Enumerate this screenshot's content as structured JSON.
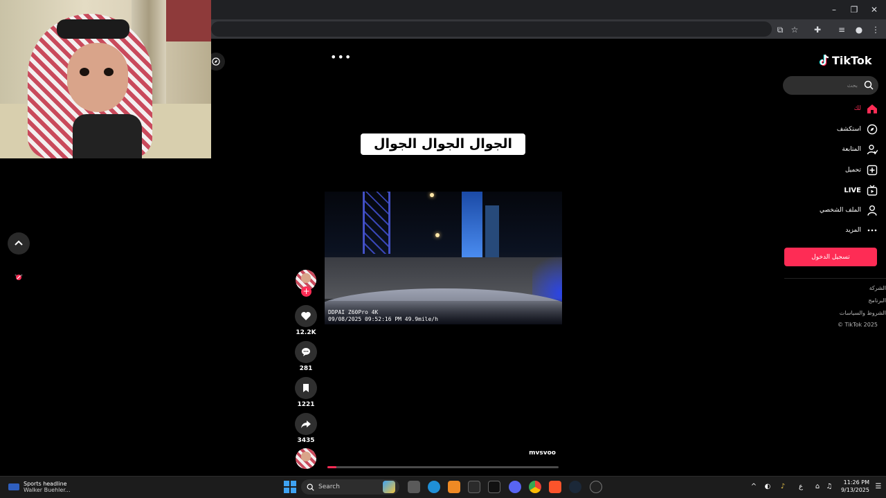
{
  "video": {
    "caption": "الجوال الجوال الجوال الجوال",
    "dashcam_brand": "DDPAI Z60Pro 4K",
    "dashcam_stamp": "09/08/2025 09:52:16 PM  49.9mile/h",
    "username": "mvsvoo",
    "progress_fraction": 0.04
  },
  "actions": {
    "likes": "12.2K",
    "comments": "281",
    "saves": "1221",
    "shares": "3435"
  },
  "sidebar": {
    "logo": "TikTok",
    "search_placeholder": "بحث",
    "items": [
      {
        "label": "لك",
        "icon": "home-icon",
        "active": true
      },
      {
        "label": "استكشف",
        "icon": "compass-icon"
      },
      {
        "label": "المتابعة",
        "icon": "following-icon"
      },
      {
        "label": "تحميل",
        "icon": "upload-icon"
      },
      {
        "label": "LIVE",
        "icon": "live-icon"
      },
      {
        "label": "الملف الشخصي",
        "icon": "profile-icon"
      },
      {
        "label": "المزيد",
        "icon": "more-icon"
      }
    ],
    "login_label": "تسجيل الدخول",
    "footer": [
      "الشركة",
      "البرنامج",
      "الشروط والسياسات",
      "© TikTok 2025"
    ]
  },
  "taskbar": {
    "news_title": "Sports headline",
    "news_sub": "Walker Buehler...",
    "search_label": "Search",
    "lang": "ع",
    "time": "11:26 PM",
    "date": "9/13/2025"
  },
  "colors": {
    "accent": "#fe2c55",
    "background": "#000000",
    "panel": "#2f2f2f"
  }
}
